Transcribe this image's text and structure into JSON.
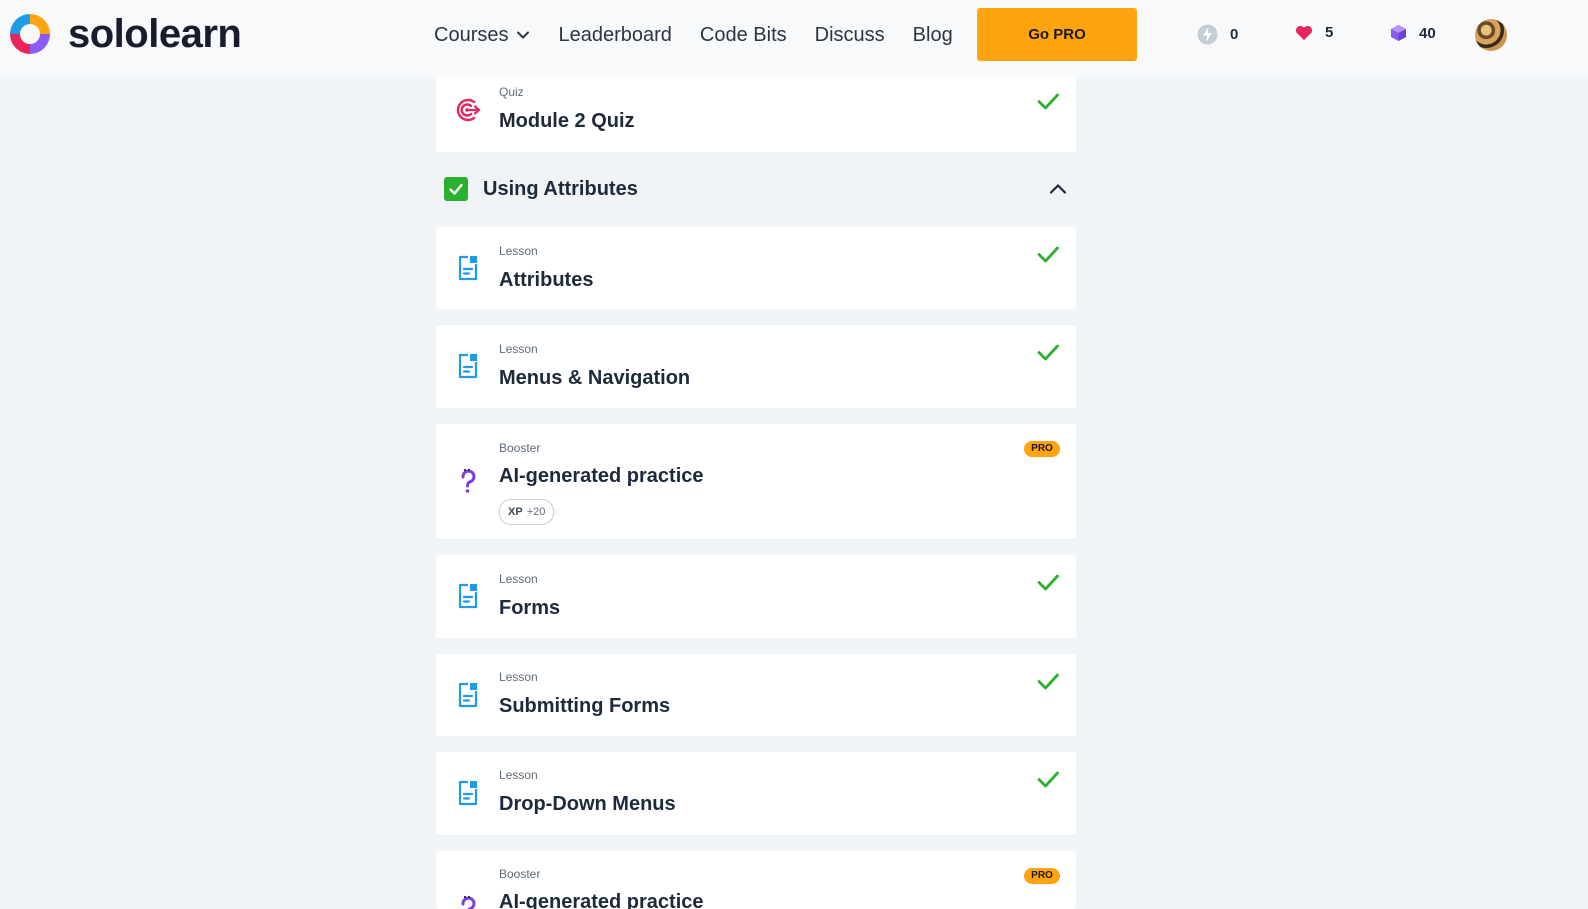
{
  "brand": {
    "name": "sololearn"
  },
  "nav": {
    "courses": "Courses",
    "leaderboard": "Leaderboard",
    "code_bits": "Code Bits",
    "discuss": "Discuss",
    "blog": "Blog"
  },
  "go_pro_label": "Go PRO",
  "stats": {
    "streak": "0",
    "hearts": "5",
    "gems": "40"
  },
  "colors": {
    "accent": "#ffa310",
    "success": "#2bb031",
    "lesson_icon": "#1f9be8",
    "quiz_icon": "#e8265e",
    "booster_icon": "#7b3fe4",
    "heart": "#e8265e",
    "gem": "#8a5cf5"
  },
  "items": {
    "quiz": {
      "type": "Quiz",
      "title": "Module 2 Quiz",
      "icon": "target-icon",
      "completed": true
    },
    "section": {
      "title": "Using Attributes",
      "completed": true,
      "expanded": true
    },
    "attributes": {
      "type": "Lesson",
      "title": "Attributes",
      "icon": "document-icon",
      "completed": true
    },
    "menus": {
      "type": "Lesson",
      "title": "Menus & Navigation",
      "icon": "document-icon",
      "completed": true
    },
    "booster1": {
      "type": "Booster",
      "title": "AI-generated practice",
      "icon": "question-icon",
      "badge": "PRO",
      "xp_label": "XP",
      "xp_value": "+20"
    },
    "forms": {
      "type": "Lesson",
      "title": "Forms",
      "icon": "document-icon",
      "completed": true
    },
    "submitting": {
      "type": "Lesson",
      "title": "Submitting Forms",
      "icon": "document-icon",
      "completed": true
    },
    "dropdown": {
      "type": "Lesson",
      "title": "Drop-Down Menus",
      "icon": "document-icon",
      "completed": true
    },
    "booster2": {
      "type": "Booster",
      "title": "AI-generated practice",
      "icon": "question-icon",
      "badge": "PRO"
    }
  }
}
